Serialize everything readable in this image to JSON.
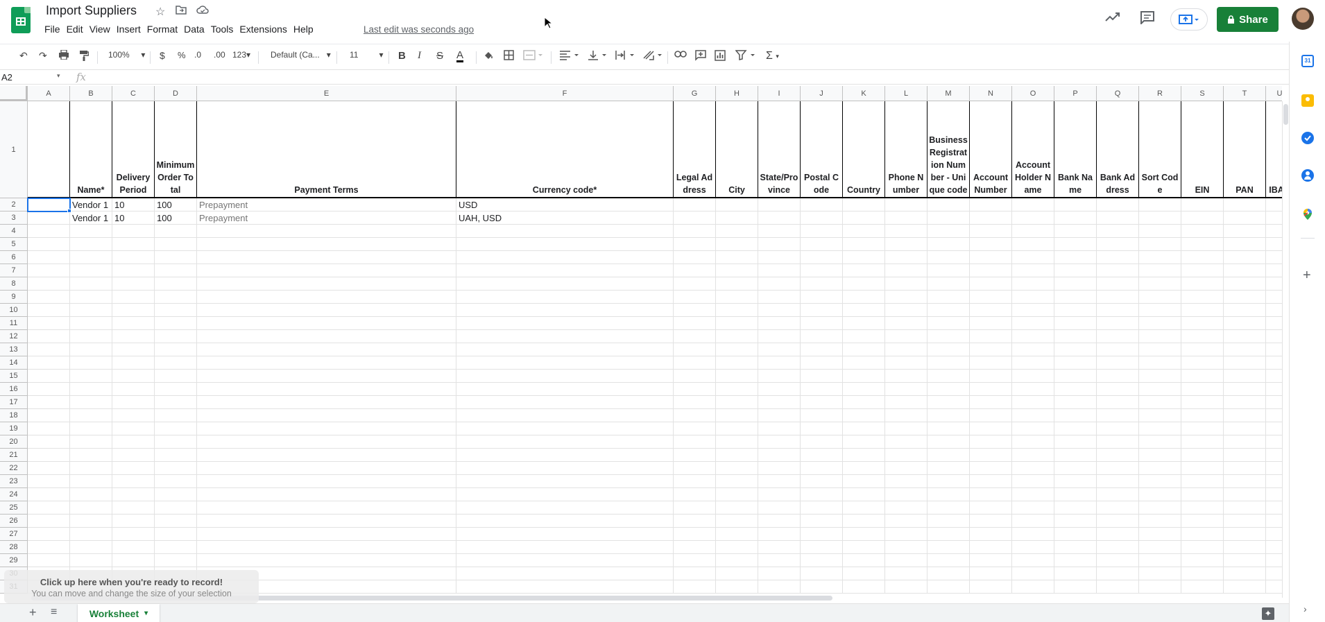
{
  "doc": {
    "title": "Import Suppliers",
    "last_edit": "Last edit was seconds ago"
  },
  "menu": [
    "File",
    "Edit",
    "View",
    "Insert",
    "Format",
    "Data",
    "Tools",
    "Extensions",
    "Help"
  ],
  "header_actions": {
    "share_label": "Share"
  },
  "toolbar": {
    "zoom": "100%",
    "currency": "$",
    "percent": "%",
    "dec_decrease": ".0",
    "dec_increase": ".00",
    "more_formats": "123",
    "font": "Default (Ca...",
    "font_size": "11",
    "bold": "B",
    "italic": "I",
    "strike": "S",
    "text_color": "A",
    "sum": "Σ"
  },
  "formula_bar": {
    "cell_ref": "A2",
    "fx": "fx",
    "value": ""
  },
  "grid": {
    "columns": [
      "A",
      "B",
      "C",
      "D",
      "E",
      "F",
      "G",
      "H",
      "I",
      "J",
      "K",
      "L",
      "M",
      "N",
      "O",
      "P",
      "Q",
      "R",
      "S",
      "T",
      "U"
    ],
    "header_row": [
      "",
      "Name*",
      "Delivery Period",
      "Minimum Order Total",
      "Payment Terms",
      "Currency code*",
      "Legal Address",
      "City",
      "State/Province",
      "Postal Code",
      "Country",
      "Phone Number",
      "Business Registration Number - Unique code",
      "Account Number",
      "Account Holder Name",
      "Bank Name",
      "Bank Address",
      "Sort Code",
      "EIN",
      "PAN",
      "IBAN"
    ],
    "rows": [
      [
        "",
        "Vendor 1",
        "10",
        "100",
        "Prepayment",
        "USD"
      ],
      [
        "",
        "Vendor 1",
        "10",
        "100",
        "Prepayment",
        "UAH, USD"
      ]
    ],
    "row_numbers": [
      "1",
      "2",
      "3",
      "4",
      "5",
      "6",
      "7",
      "8",
      "9",
      "10",
      "11",
      "12",
      "13",
      "14",
      "15",
      "16",
      "17",
      "18",
      "19",
      "20",
      "21",
      "22",
      "23",
      "24",
      "25",
      "26",
      "27",
      "28",
      "29",
      "30",
      "31"
    ]
  },
  "overlay": {
    "title": "Click up here when you're ready to record!",
    "subtitle": "You can move and change the size of your selection"
  },
  "sheets": {
    "active": "Worksheet"
  },
  "colors": {
    "brand_green": "#188038",
    "selection_blue": "#1a73e8"
  }
}
